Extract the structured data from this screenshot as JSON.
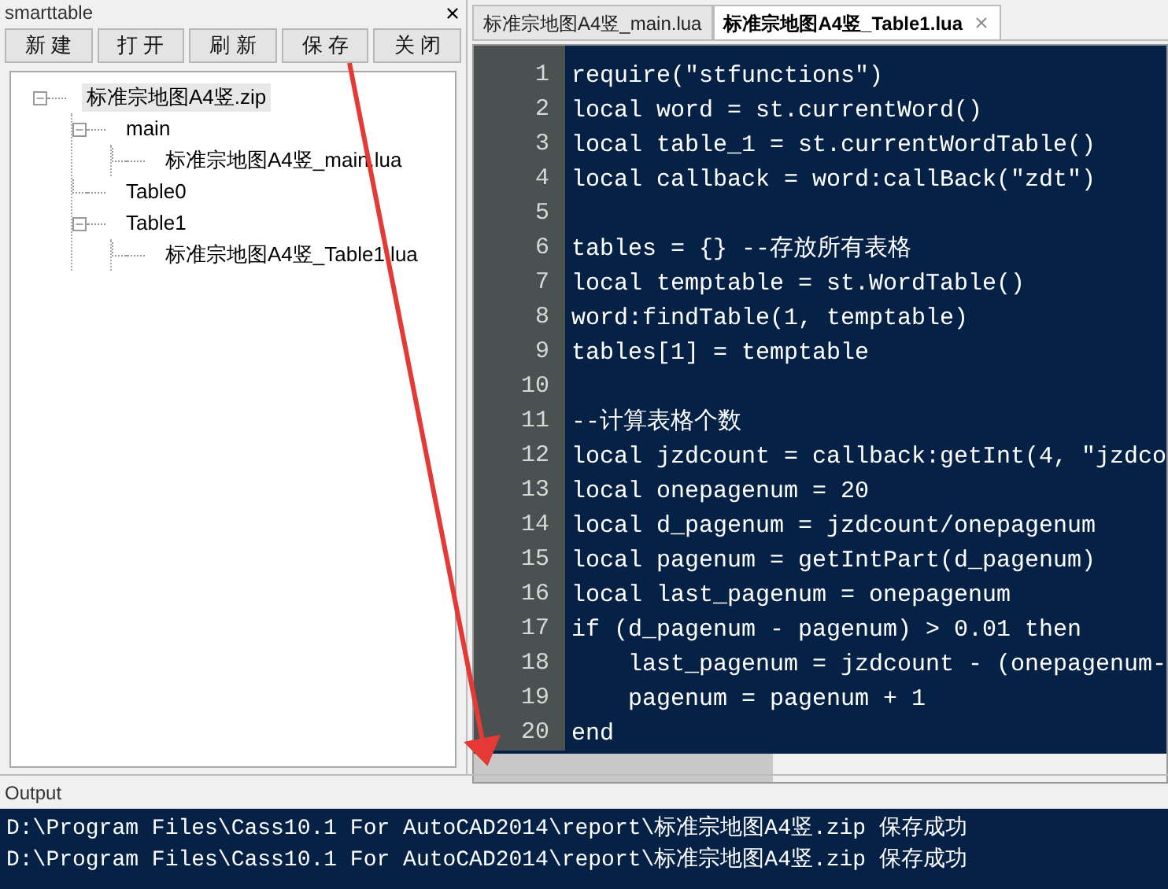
{
  "panel": {
    "title": "smarttable",
    "buttons": [
      "新 建",
      "打 开",
      "刷 新",
      "保 存",
      "关 闭"
    ],
    "tree": [
      {
        "label": "标准宗地图A4竖.zip",
        "selected": true,
        "expanded": true,
        "children": [
          {
            "label": "main",
            "selected": false,
            "expanded": true,
            "children": [
              {
                "label": "标准宗地图A4竖_main.lua",
                "selected": false
              }
            ]
          },
          {
            "label": "Table0",
            "selected": false
          },
          {
            "label": "Table1",
            "selected": false,
            "expanded": true,
            "children": [
              {
                "label": "标准宗地图A4竖_Table1.lua",
                "selected": false
              }
            ]
          }
        ]
      }
    ]
  },
  "editor": {
    "tabs": [
      {
        "label": "标准宗地图A4竖_main.lua",
        "selected": false
      },
      {
        "label": "标准宗地图A4竖_Table1.lua",
        "selected": true
      }
    ],
    "lines": [
      {
        "number": "1",
        "code": "require(\"stfunctions\")"
      },
      {
        "number": "2",
        "code": "local word = st.currentWord()"
      },
      {
        "number": "3",
        "code": "local table_1 = st.currentWordTable()"
      },
      {
        "number": "4",
        "code": "local callback = word:callBack(\"zdt\")"
      },
      {
        "number": "5"
      },
      {
        "number": "6",
        "code": "tables = {} --存放所有表格"
      },
      {
        "number": "7",
        "code": "local temptable = st.WordTable()"
      },
      {
        "number": "8",
        "code": "word:findTable(1, temptable)"
      },
      {
        "number": "9",
        "code": "tables[1] = temptable"
      },
      {
        "number": "10"
      },
      {
        "number": "11",
        "code": "--计算表格个数"
      },
      {
        "number": "12",
        "code": "local jzdcount = callback:getInt(4, \"jzdco"
      },
      {
        "number": "13",
        "code": "local onepagenum = 20"
      },
      {
        "number": "14",
        "code": "local d_pagenum = jzdcount/onepagenum"
      },
      {
        "number": "15",
        "code": "local pagenum = getIntPart(d_pagenum)"
      },
      {
        "number": "16",
        "code": "local last_pagenum = onepagenum"
      },
      {
        "number": "17",
        "code": "if (d_pagenum - pagenum) > 0.01 then"
      },
      {
        "number": "18",
        "code": "    last_pagenum = jzdcount - (onepagenum-"
      },
      {
        "number": "19",
        "code": "    pagenum = pagenum + 1"
      },
      {
        "number": "20",
        "code": "end"
      }
    ]
  },
  "output": {
    "title": "Output",
    "lines": [
      "D:\\Program Files\\Cass10.1 For AutoCAD2014\\report\\标准宗地图A4竖.zip 保存成功",
      "D:\\Program Files\\Cass10.1 For AutoCAD2014\\report\\标准宗地图A4竖.zip 保存成功"
    ]
  }
}
